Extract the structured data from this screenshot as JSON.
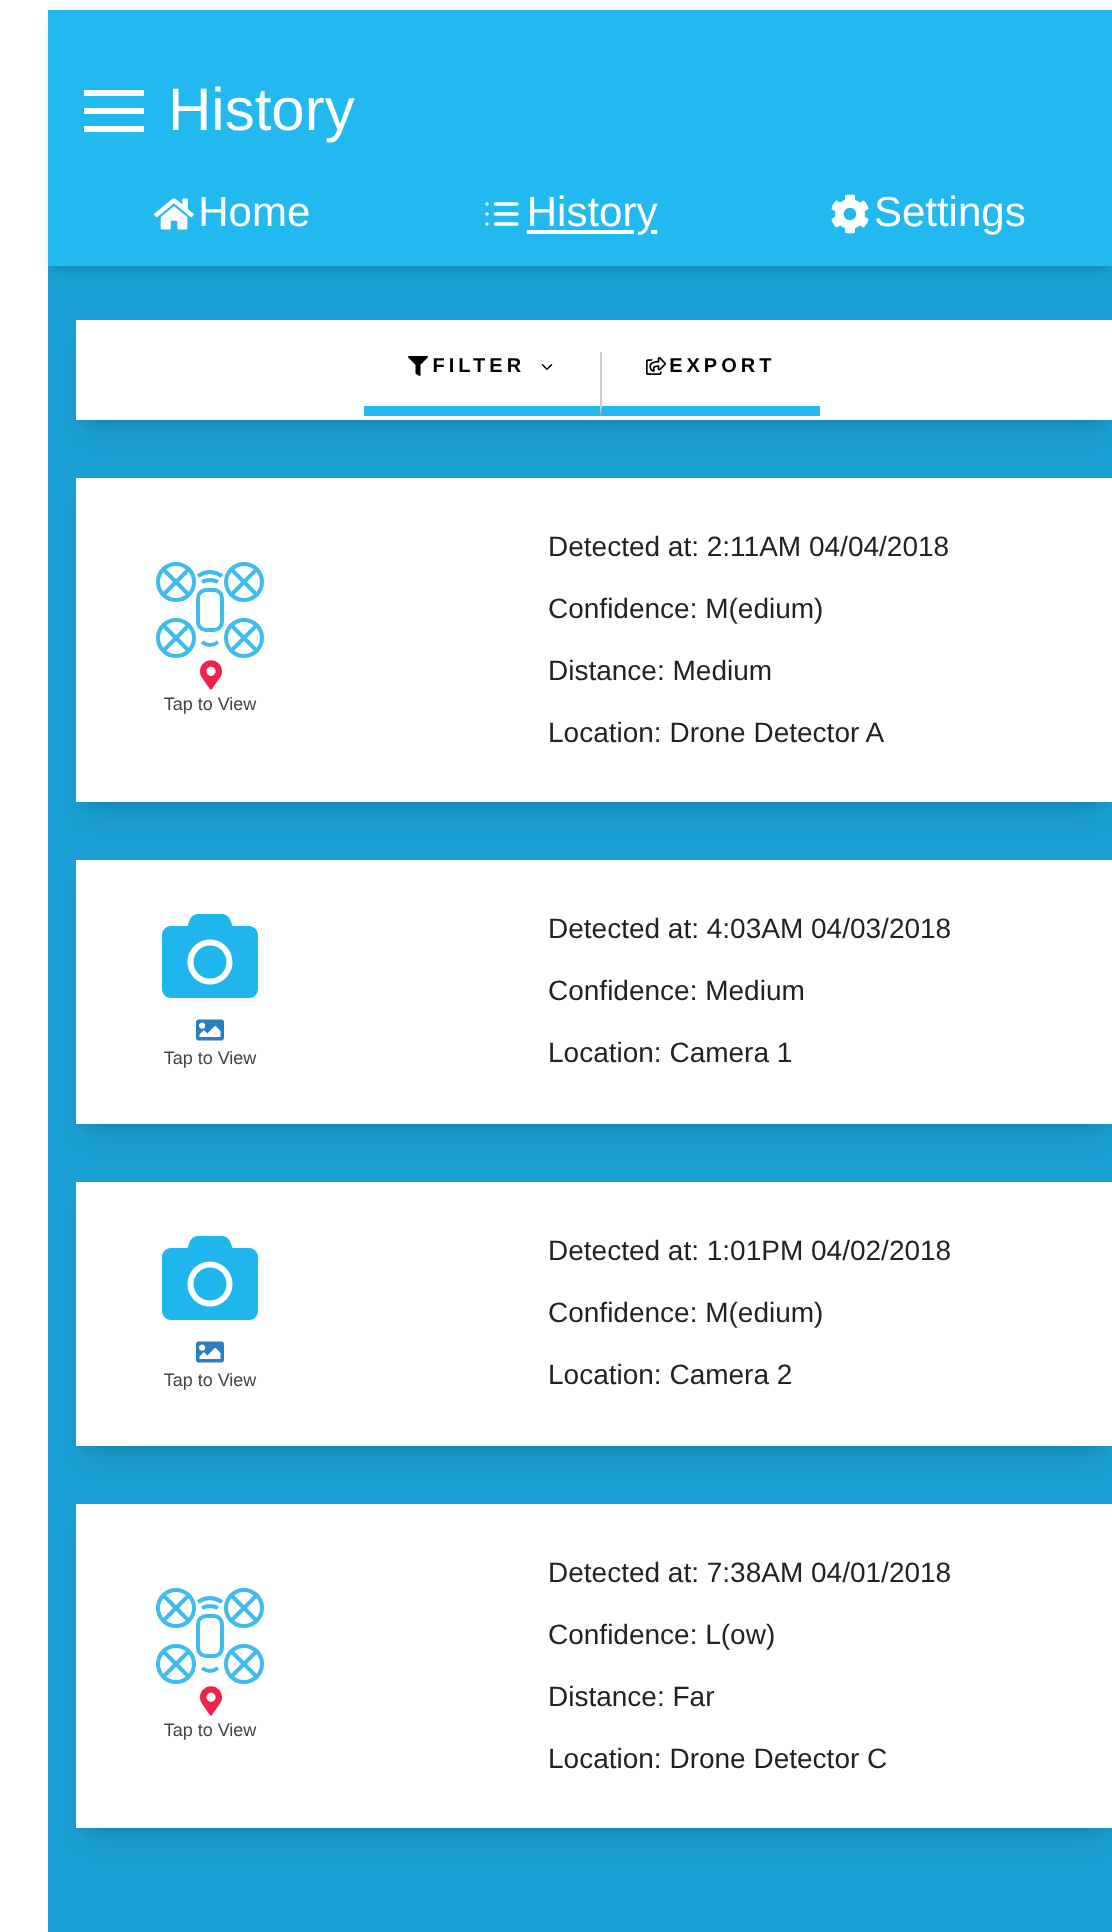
{
  "header": {
    "title": "History"
  },
  "nav": [
    {
      "label": "Home",
      "kind": "home",
      "selected": false
    },
    {
      "label": "History",
      "kind": "list",
      "selected": true
    },
    {
      "label": "Settings",
      "kind": "gear",
      "selected": false
    }
  ],
  "toolbar": [
    {
      "label": "FILTER",
      "kind": "filter",
      "dropdown": true
    },
    {
      "label": "EXPORT",
      "kind": "export",
      "dropdown": false
    }
  ],
  "detections": [
    {
      "kind": "drone",
      "action": "Tap to View",
      "lines": [
        "Detected at: 2:11AM 04/04/2018",
        "Confidence: M(edium)",
        "Distance: Medium",
        "Location: Drone Detector A"
      ]
    },
    {
      "kind": "camera",
      "action": "Tap to View",
      "lines": [
        "Detected at: 4:03AM 04/03/2018",
        "Confidence: Medium",
        "Location: Camera 1"
      ]
    },
    {
      "kind": "camera",
      "action": "Tap to View",
      "lines": [
        "Detected at: 1:01PM 04/02/2018",
        "Confidence: M(edium)",
        "Location: Camera 2"
      ]
    },
    {
      "kind": "drone",
      "action": "Tap to View",
      "lines": [
        "Detected at: 7:38AM 04/01/2018",
        "Confidence: L(ow)",
        "Distance: Far",
        "Location: Drone Detector C"
      ]
    }
  ]
}
